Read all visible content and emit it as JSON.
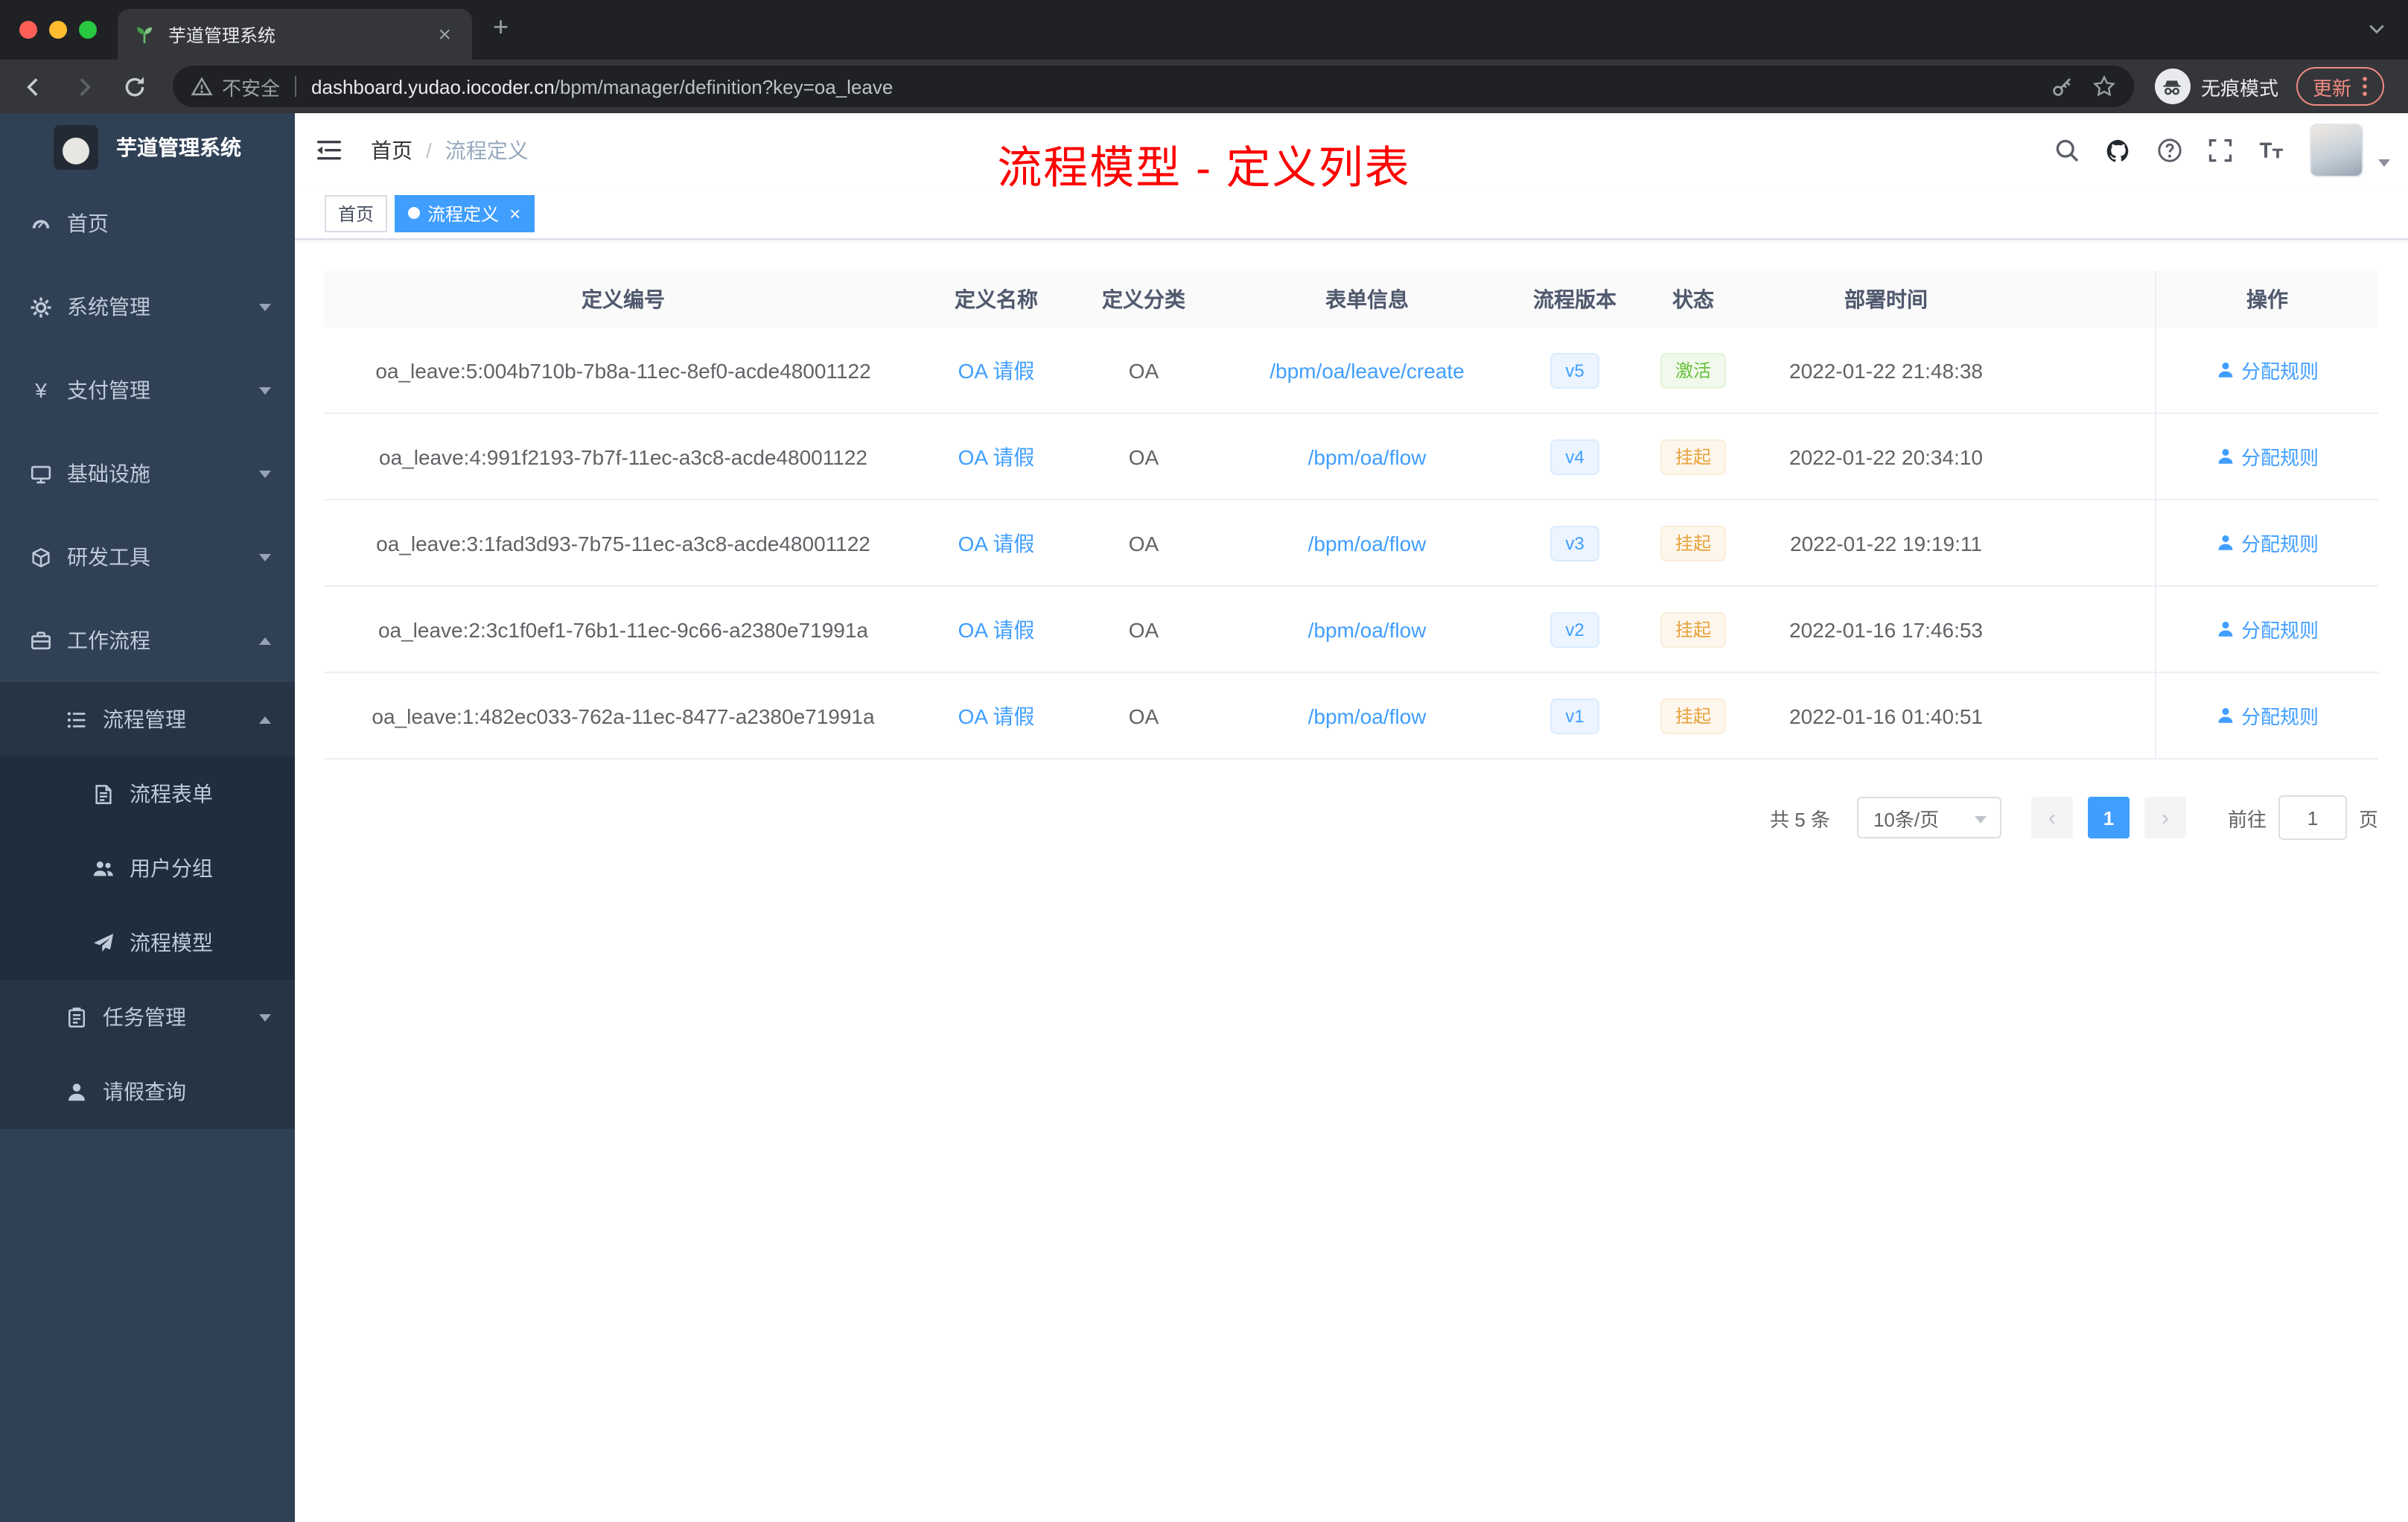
{
  "accent_colors": {
    "primary": "#409eff",
    "success": "#67c23a",
    "warning": "#e6a23c",
    "annotation_red": "#fd0000",
    "sidebar_bg": "#304156"
  },
  "browser": {
    "tab_title": "芋道管理系统",
    "security_label": "不安全",
    "url_host": "dashboard.yudao.iocoder.cn",
    "url_path": "/bpm/manager/definition?key=oa_leave",
    "incognito_label": "无痕模式",
    "update_label": "更新"
  },
  "sidebar": {
    "logo_title": "芋道管理系统",
    "items": [
      {
        "icon": "gauge-icon",
        "label": "首页",
        "level": 1
      },
      {
        "icon": "gear-icon",
        "label": "系统管理",
        "level": 1,
        "state": "collapsed"
      },
      {
        "icon": "yen-icon",
        "label": "支付管理",
        "level": 1,
        "state": "collapsed"
      },
      {
        "icon": "monitor-icon",
        "label": "基础设施",
        "level": 1,
        "state": "collapsed"
      },
      {
        "icon": "cube-icon",
        "label": "研发工具",
        "level": 1,
        "state": "collapsed"
      },
      {
        "icon": "briefcase-icon",
        "label": "工作流程",
        "level": 1,
        "state": "expanded"
      },
      {
        "icon": "list-icon",
        "label": "流程管理",
        "level": 2,
        "state": "expanded"
      },
      {
        "icon": "document-icon",
        "label": "流程表单",
        "level": 3
      },
      {
        "icon": "users-icon",
        "label": "用户分组",
        "level": 3
      },
      {
        "icon": "paper-plane-icon",
        "label": "流程模型",
        "level": 3
      },
      {
        "icon": "clipboard-icon",
        "label": "任务管理",
        "level": 2,
        "state": "collapsed"
      },
      {
        "icon": "user-icon",
        "label": "请假查询",
        "level": 2
      }
    ]
  },
  "topbar": {
    "breadcrumb_home": "首页",
    "breadcrumb_separator": "/",
    "breadcrumb_current": "流程定义",
    "annotation": "流程模型 - 定义列表"
  },
  "tags": {
    "home": "首页",
    "active": "流程定义"
  },
  "table": {
    "columns": [
      "定义编号",
      "定义名称",
      "定义分类",
      "表单信息",
      "流程版本",
      "状态",
      "部署时间",
      "操作"
    ],
    "rows": [
      {
        "id": "oa_leave:5:004b710b-7b8a-11ec-8ef0-acde48001122",
        "name": "OA 请假",
        "category": "OA",
        "form": "/bpm/oa/leave/create",
        "version": "v5",
        "status": "激活",
        "status_type": "success",
        "time": "2022-01-22 21:48:38",
        "action": "分配规则"
      },
      {
        "id": "oa_leave:4:991f2193-7b7f-11ec-a3c8-acde48001122",
        "name": "OA 请假",
        "category": "OA",
        "form": "/bpm/oa/flow",
        "version": "v4",
        "status": "挂起",
        "status_type": "warning",
        "time": "2022-01-22 20:34:10",
        "action": "分配规则"
      },
      {
        "id": "oa_leave:3:1fad3d93-7b75-11ec-a3c8-acde48001122",
        "name": "OA 请假",
        "category": "OA",
        "form": "/bpm/oa/flow",
        "version": "v3",
        "status": "挂起",
        "status_type": "warning",
        "time": "2022-01-22 19:19:11",
        "action": "分配规则"
      },
      {
        "id": "oa_leave:2:3c1f0ef1-76b1-11ec-9c66-a2380e71991a",
        "name": "OA 请假",
        "category": "OA",
        "form": "/bpm/oa/flow",
        "version": "v2",
        "status": "挂起",
        "status_type": "warning",
        "time": "2022-01-16 17:46:53",
        "action": "分配规则"
      },
      {
        "id": "oa_leave:1:482ec033-762a-11ec-8477-a2380e71991a",
        "name": "OA 请假",
        "category": "OA",
        "form": "/bpm/oa/flow",
        "version": "v1",
        "status": "挂起",
        "status_type": "warning",
        "time": "2022-01-16 01:40:51",
        "action": "分配规则"
      }
    ]
  },
  "pagination": {
    "total": "共 5 条",
    "page_size": "10条/页",
    "prev": "‹",
    "page": "1",
    "next": "›",
    "goto_label": "前往",
    "goto_value": "1",
    "unit": "页"
  }
}
